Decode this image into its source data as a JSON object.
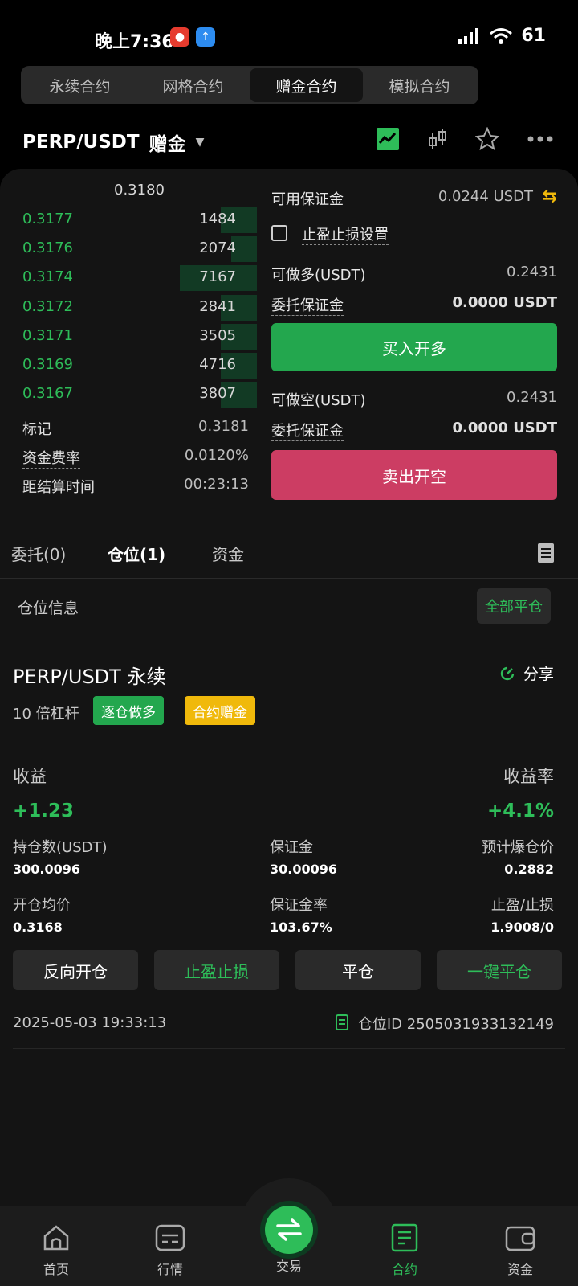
{
  "status": {
    "time": "晚上7:36",
    "battery": "61"
  },
  "mode_tabs": [
    "永续合约",
    "网格合约",
    "赠金合约",
    "模拟合约"
  ],
  "pair": {
    "symbol": "PERP/USDT",
    "type": "赠金"
  },
  "orderbook": {
    "top_price": "0.3180",
    "rows": [
      {
        "price": "0.3177",
        "qty": "1484",
        "fill": 0.14
      },
      {
        "price": "0.3176",
        "qty": "2074",
        "fill": 0.1
      },
      {
        "price": "0.3174",
        "qty": "7167",
        "fill": 0.3
      },
      {
        "price": "0.3172",
        "qty": "2841",
        "fill": 0.14
      },
      {
        "price": "0.3171",
        "qty": "3505",
        "fill": 0.14
      },
      {
        "price": "0.3169",
        "qty": "4716",
        "fill": 0.14
      },
      {
        "price": "0.3167",
        "qty": "3807",
        "fill": 0.14
      }
    ],
    "mark_label": "标记",
    "mark_value": "0.3181",
    "funding_label": "资金费率",
    "funding_value": "0.0120%",
    "settle_label": "距结算时间",
    "settle_value": "00:23:13"
  },
  "order": {
    "margin_label": "可用保证金",
    "margin_value": "0.0244 USDT",
    "tpsl_label": "止盈止损设置",
    "long_label": "可做多(USDT)",
    "long_value": "0.2431",
    "entrust_label": "委托保证金",
    "entrust_value": "0.0000 USDT",
    "buy_label": "买入开多",
    "short_label": "可做空(USDT)",
    "short_value": "0.2431",
    "entrust2_label": "委托保证金",
    "entrust2_value": "0.0000 USDT",
    "sell_label": "卖出开空"
  },
  "tabs": [
    "委托(0)",
    "仓位(1)",
    "资金"
  ],
  "position": {
    "section_title": "仓位信息",
    "close_all": "全部平仓",
    "title": "PERP/USDT 永续",
    "share": "分享",
    "leverage": "10 倍杠杆",
    "tag1": "逐仓做多",
    "tag2": "合约赠金",
    "pnl_label": "收益",
    "pnl_value": "+1.23",
    "roe_label": "收益率",
    "roe_value": "+4.1%",
    "size_label": "持仓数(USDT)",
    "size_value": "300.0096",
    "margin_label": "保证金",
    "margin_value": "30.00096",
    "liq_label": "预计爆仓价",
    "liq_value": "0.2882",
    "entry_label": "开仓均价",
    "entry_value": "0.3168",
    "ratio_label": "保证金率",
    "ratio_value": "103.67%",
    "tpsl_label": "止盈/止损",
    "tpsl_value": "1.9008/0",
    "actions": [
      "反向开仓",
      "止盈止损",
      "平仓",
      "一键平仓"
    ],
    "time": "2025-05-03 19:33:13",
    "id_label": "仓位ID 2505031933132149"
  },
  "nav": [
    "首页",
    "行情",
    "交易",
    "合约",
    "资金"
  ],
  "colors": {
    "green": "#2ebd59",
    "red": "#cc3d63",
    "yellow": "#f0b90b"
  }
}
